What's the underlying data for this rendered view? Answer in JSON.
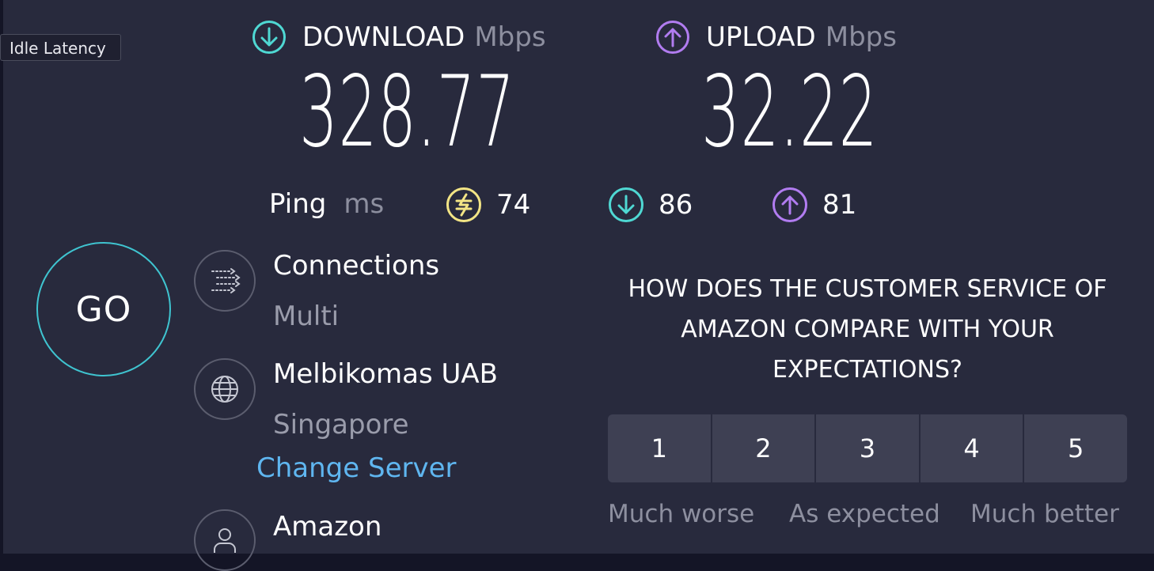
{
  "tooltip": "Idle Latency",
  "download": {
    "label": "DOWNLOAD",
    "unit": "Mbps",
    "value": "328.77",
    "icon": "arrow-down-circle-icon",
    "color": "#4fd8d3"
  },
  "upload": {
    "label": "UPLOAD",
    "unit": "Mbps",
    "value": "32.22",
    "icon": "arrow-up-circle-icon",
    "color": "#b17cf0"
  },
  "ping": {
    "label": "Ping",
    "unit": "ms",
    "idle": {
      "value": "74",
      "icon": "idle-latency-icon",
      "color": "#f3e585"
    },
    "download": {
      "value": "86",
      "icon": "download-latency-icon",
      "color": "#4fd8d3"
    },
    "upload": {
      "value": "81",
      "icon": "upload-latency-icon",
      "color": "#b17cf0"
    }
  },
  "go_label": "GO",
  "connections": {
    "title": "Connections",
    "value": "Multi",
    "icon": "connections-icon"
  },
  "server": {
    "title": "Melbikomas UAB",
    "location": "Singapore",
    "change_label": "Change Server",
    "icon": "globe-icon"
  },
  "provider": {
    "title": "Amazon",
    "icon": "user-icon"
  },
  "survey": {
    "question": "HOW DOES THE CUSTOMER SERVICE OF AMAZON COMPARE WITH YOUR EXPECTATIONS?",
    "options": [
      "1",
      "2",
      "3",
      "4",
      "5"
    ],
    "scale_low": "Much worse",
    "scale_mid": "As expected",
    "scale_high": "Much better"
  }
}
